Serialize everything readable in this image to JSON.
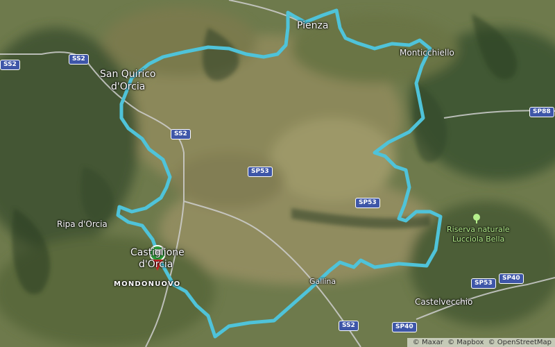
{
  "map": {
    "places": [
      {
        "id": "pienza",
        "label": "Pienza",
        "class": "big"
      },
      {
        "id": "monticchiello",
        "label": "Monticchiello",
        "class": "mid"
      },
      {
        "id": "san-quirico-1",
        "label": "San Quirico",
        "class": "big"
      },
      {
        "id": "san-quirico-2",
        "label": "d'Orcia",
        "class": "big"
      },
      {
        "id": "ripa",
        "label": "Ripa d'Orcia",
        "class": "mid"
      },
      {
        "id": "castiglione-1",
        "label": "Castiglione",
        "class": "big"
      },
      {
        "id": "castiglione-2",
        "label": "d'Orcia",
        "class": "big"
      },
      {
        "id": "mondonuovo",
        "label": "MONDONUOVO",
        "class": "caps"
      },
      {
        "id": "gallina",
        "label": "Gallina",
        "class": "small"
      },
      {
        "id": "castelvecchio",
        "label": "Castelvecchio",
        "class": "mid"
      },
      {
        "id": "riserva-1",
        "label": "Riserva naturale",
        "class": "nature"
      },
      {
        "id": "riserva-2",
        "label": "Lucciola Bella",
        "class": "nature"
      }
    ],
    "road_shields": [
      "SS2",
      "SS2",
      "SS2",
      "SP53",
      "SP53",
      "SP53",
      "SP88",
      "SP40",
      "SP40",
      "SS2"
    ],
    "attribution": [
      "© Maxar",
      "© Mapbox",
      "© OpenStreetMap"
    ],
    "route_color": "#4fc3d9",
    "start_marker_colors": [
      "#2e9e3a",
      "#ffffff",
      "#d62828"
    ]
  }
}
